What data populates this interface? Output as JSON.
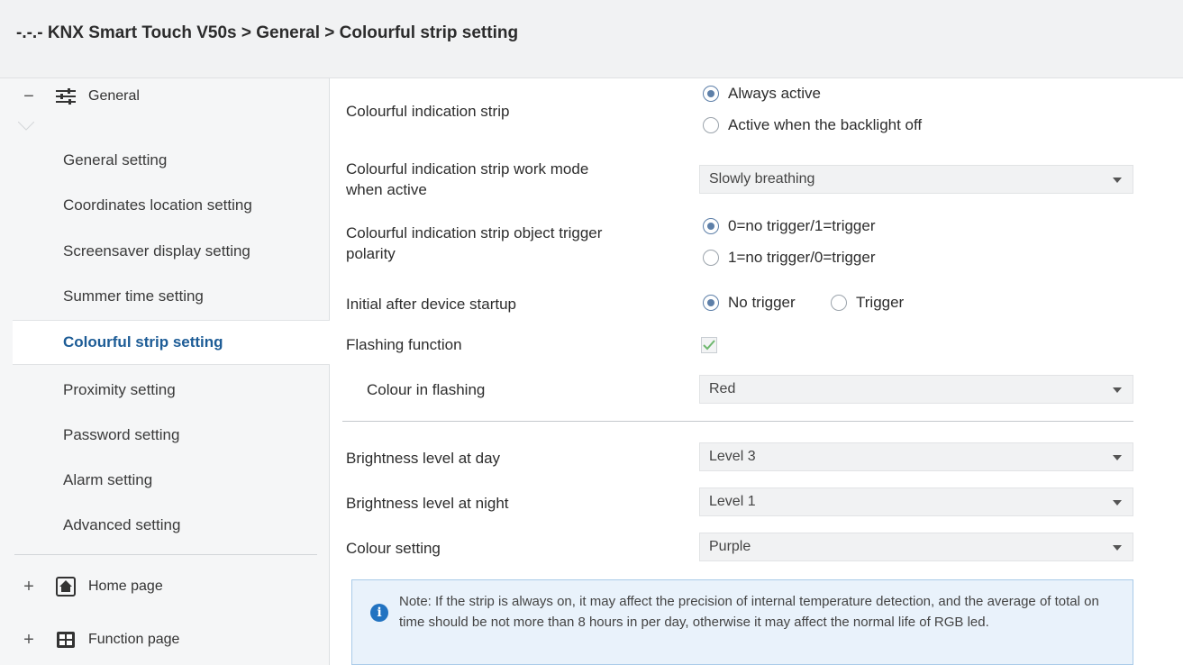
{
  "window": {
    "title": "-.-.- KNX Smart Touch V50s > General > Colourful strip setting"
  },
  "sidebar": {
    "groups": [
      {
        "expander": "−",
        "icon": "sliders-icon",
        "label": "General"
      },
      {
        "expander": "+",
        "icon": "home-icon",
        "label": "Home page"
      },
      {
        "expander": "+",
        "icon": "grid-icon",
        "label": "Function page"
      }
    ],
    "items": [
      {
        "label": "General setting"
      },
      {
        "label": "Coordinates location setting"
      },
      {
        "label": "Screensaver display setting"
      },
      {
        "label": "Summer time setting"
      },
      {
        "label": "Colourful strip setting",
        "active": true
      },
      {
        "label": "Proximity setting"
      },
      {
        "label": "Password setting"
      },
      {
        "label": "Alarm setting"
      },
      {
        "label": "Advanced setting"
      }
    ]
  },
  "params": {
    "strip": {
      "label": "Colourful indication strip",
      "options": [
        "Always active",
        "Active when the backlight off"
      ],
      "selected": 0
    },
    "work_mode": {
      "label_line1": "Colourful indication strip work mode",
      "label_line2": "when active",
      "value": "Slowly breathing"
    },
    "polarity": {
      "label_line1": "Colourful  indication strip object trigger",
      "label_line2": "polarity",
      "options": [
        "0=no trigger/1=trigger",
        "1=no trigger/0=trigger"
      ],
      "selected": 0
    },
    "initial": {
      "label": "Initial after device startup",
      "options": [
        "No trigger",
        "Trigger"
      ],
      "selected": 0
    },
    "flashing": {
      "label": "Flashing function",
      "checked": true
    },
    "flash_colour": {
      "label": "Colour in flashing",
      "value": "Red"
    },
    "day": {
      "label": "Brightness level at day",
      "value": "Level 3"
    },
    "night": {
      "label": "Brightness level at night",
      "value": "Level 1"
    },
    "colour": {
      "label": "Colour setting",
      "value": "Purple"
    }
  },
  "note": {
    "text": "Note: If the strip is always on, it may affect the precision of internal temperature detection, and the average of total on time should be not more than 8 hours in per day, otherwise it may affect the normal life of RGB led."
  },
  "colors": {
    "accent": "#1d5c96",
    "radio": "#5d7fa8",
    "check": "#6fb86f",
    "note_bg": "#e9f2fb",
    "note_border": "#a9cbe9"
  }
}
